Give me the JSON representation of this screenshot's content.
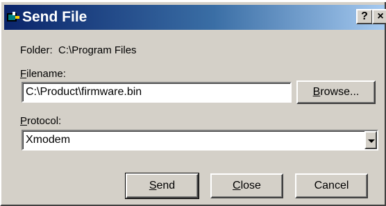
{
  "window": {
    "title": "Send File",
    "help_label": "?",
    "close_label": "×"
  },
  "folder": {
    "label_prefix": "Folder:",
    "path": "C:\\Program Files"
  },
  "filename": {
    "label_access": "F",
    "label_rest": "ilename:",
    "value": "C:\\Product\\firmware.bin"
  },
  "browse": {
    "label_access": "B",
    "label_rest": "rowse..."
  },
  "protocol": {
    "label_access": "P",
    "label_rest": "rotocol:",
    "selected": "Xmodem"
  },
  "buttons": {
    "send_access": "S",
    "send_rest": "end",
    "close_access": "C",
    "close_rest": "lose",
    "cancel": "Cancel"
  },
  "colors": {
    "titlebar_start": "#0a246a",
    "titlebar_end": "#a6caf0",
    "dialog_face": "#d4d0c8"
  },
  "icons": {
    "title_icon": "application-icon",
    "dropdown_icon": "chevron-down-icon"
  }
}
